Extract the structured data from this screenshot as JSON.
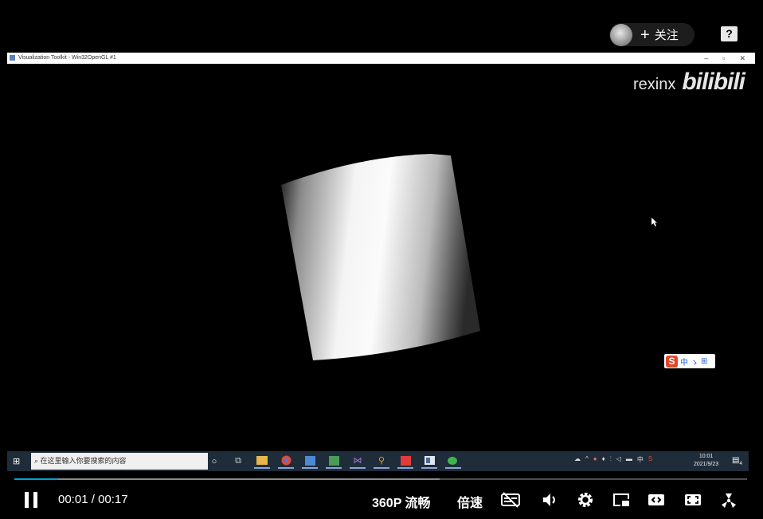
{
  "uploader_overlay": {
    "follow_plus": "+",
    "follow_label": "关注",
    "help_label": "?"
  },
  "recorded_window": {
    "title": "Visualization Toolkit - Win32OpenGL #1",
    "controls": [
      "–",
      "▫",
      "✕"
    ]
  },
  "watermark": {
    "user": "rexinx",
    "logo": "bilibili"
  },
  "ime_badge": {
    "logo": "S",
    "items": [
      "中",
      "ゝ",
      "⊞"
    ]
  },
  "taskbar": {
    "start_icon": "windows-icon",
    "search_placeholder": "在这里输入你要搜索的内容",
    "apps": [
      "task-view-icon",
      "explorer-icon",
      "chrome-icon",
      "remote-icon",
      "image-icon",
      "visual-studio-icon",
      "search-app-icon",
      "red-app-icon",
      "window-app-icon",
      "wechat-icon"
    ],
    "clock_time": "10:01",
    "clock_date": "2021/9/23",
    "notification_count": "4"
  },
  "player": {
    "progress": 0.06,
    "buffered": 0.58,
    "current_time": "00:01",
    "separator": "/",
    "duration": "00:17",
    "quality": "360P 流畅",
    "speed": "倍速",
    "icons": [
      "subtitle-off-icon",
      "volume-icon",
      "settings-icon",
      "picture-in-picture-icon",
      "widescreen-icon",
      "web-fullscreen-icon",
      "fullscreen-icon"
    ],
    "colors": {
      "progress": "#00a1d6",
      "buffer": "#8a8a8a",
      "track": "#4d4d4d"
    }
  }
}
